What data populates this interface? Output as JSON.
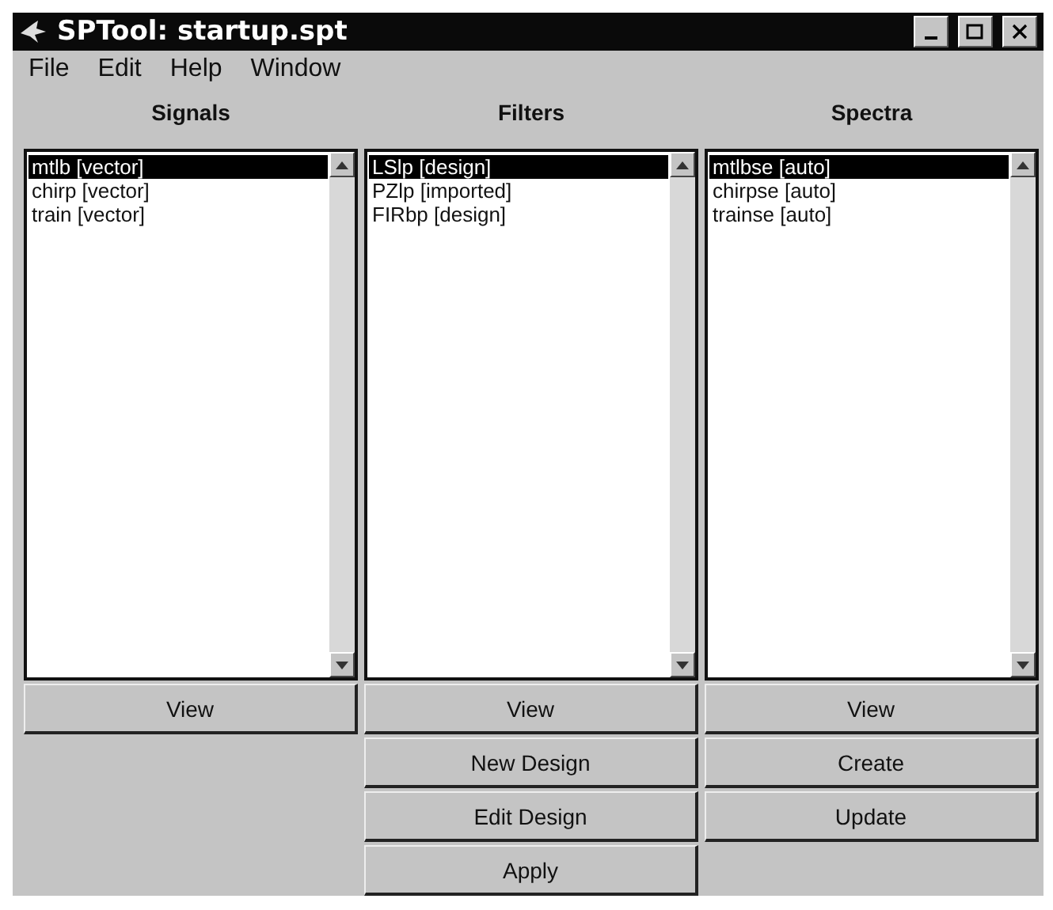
{
  "window": {
    "title": "SPTool: startup.spt"
  },
  "menu": [
    "File",
    "Edit",
    "Help",
    "Window"
  ],
  "panels": [
    {
      "title": "Signals",
      "items": [
        {
          "label": "mtlb [vector]",
          "selected": true
        },
        {
          "label": "chirp [vector]",
          "selected": false
        },
        {
          "label": "train [vector]",
          "selected": false
        }
      ],
      "buttons": [
        "View"
      ]
    },
    {
      "title": "Filters",
      "items": [
        {
          "label": "LSlp [design]",
          "selected": true
        },
        {
          "label": "PZlp [imported]",
          "selected": false
        },
        {
          "label": "FIRbp [design]",
          "selected": false
        }
      ],
      "buttons": [
        "View",
        "New Design",
        "Edit Design",
        "Apply"
      ]
    },
    {
      "title": "Spectra",
      "items": [
        {
          "label": "mtlbse [auto]",
          "selected": true
        },
        {
          "label": "chirpse [auto]",
          "selected": false
        },
        {
          "label": "trainse [auto]",
          "selected": false
        }
      ],
      "buttons": [
        "View",
        "Create",
        "Update"
      ]
    }
  ]
}
